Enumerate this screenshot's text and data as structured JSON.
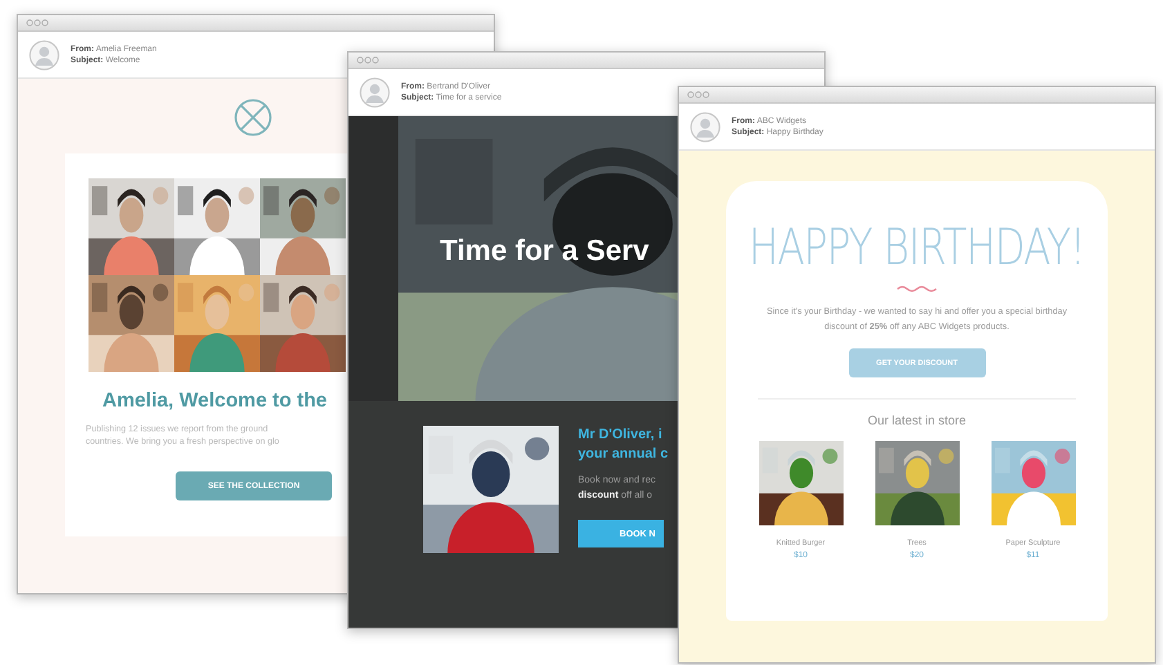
{
  "welcome_email": {
    "header": {
      "from_label": "From:",
      "from": "Amelia Freeman",
      "subject_label": "Subject:",
      "subject": "Welcome"
    },
    "photos": [
      {
        "kind": "picture"
      },
      {
        "kind": "picture"
      },
      {
        "kind": "picture"
      },
      {
        "kind": "picture"
      },
      {
        "kind": "picture"
      },
      {
        "kind": "picture"
      }
    ],
    "title": "Amelia, Welcome to the",
    "paragraph_lines": [
      "Publishing 12 issues we report from the ground",
      "countries. We bring you a fresh perspective on glo"
    ],
    "button": "SEE THE COLLECTION"
  },
  "service_email": {
    "header": {
      "from_label": "From:",
      "from": "Bertrand D'Oliver",
      "subject_label": "Subject:",
      "subject": "Time for a service"
    },
    "hero_title": "Time for a Serv",
    "title_lines": [
      "Mr D'Oliver, i",
      "your annual c"
    ],
    "paragraph_lines": [
      "Book now and rec",
      "**discount** off all o"
    ],
    "button": "BOOK N"
  },
  "birthday_email": {
    "header": {
      "from_label": "From:",
      "from": "ABC Widgets",
      "subject_label": "Subject:",
      "subject": "Happy Birthday"
    },
    "title": "HAPPY BIRTHDAY!",
    "paragraph": "Since it's your Birthday - we wanted to say hi and offer you a special birthday discount of **25%** off any ABC Widgets products.",
    "button": "GET YOUR DISCOUNT",
    "section_title": "Our latest in store",
    "products": [
      {
        "name": "Knitted Burger",
        "price": "$10"
      },
      {
        "name": "Trees",
        "price": "$20"
      },
      {
        "name": "Paper Sculpture",
        "price": "$11"
      }
    ]
  }
}
